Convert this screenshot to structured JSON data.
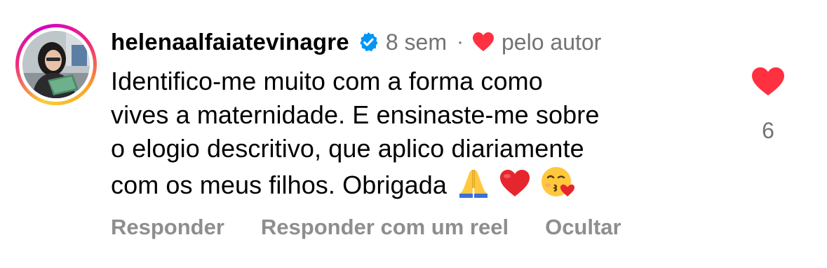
{
  "comment": {
    "username": "helenaalfaiatevinagre",
    "verified": true,
    "time_ago": "8 sem",
    "separator": "·",
    "liked_by_author_label": "pelo autor",
    "body_lines": [
      "Identifico-me muito com a forma como",
      "vives a maternidade. E ensinaste-me sobre",
      "o elogio descritivo, que aplico diariamente",
      "com os meus filhos. Obrigada"
    ],
    "trailing_emojis": [
      "folded-hands-emoji",
      "red-heart-emoji",
      "face-blowing-kiss-emoji"
    ],
    "like_count": "6",
    "liked": true
  },
  "actions": {
    "reply_label": "Responder",
    "reply_reel_label": "Responder com um reel",
    "hide_label": "Ocultar"
  },
  "colors": {
    "like_red": "#ff3040",
    "verified_blue": "#0095f6",
    "meta_gray": "#737373",
    "action_gray": "#8e8e8e"
  }
}
